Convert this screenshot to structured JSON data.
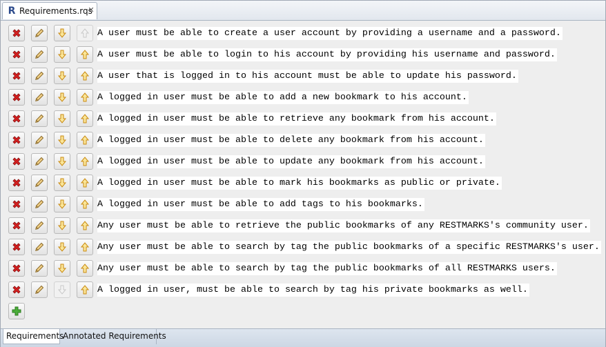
{
  "editor": {
    "tab_title": "Requirements.rqs",
    "file_icon_letter": "R"
  },
  "requirements": [
    "A user must be able to create a user account by providing a username and a password.",
    "A user must be able to login to his account by providing his username and password.",
    "A user that is logged in to his account must be able to update his password.",
    "A logged in user must be able to add a new bookmark to his account.",
    "A logged in user must be able to retrieve any bookmark from his account.",
    "A logged in user must be able to delete any bookmark from his account.",
    "A logged in user must be able to update any bookmark from his account.",
    "A logged in user must be able to mark his bookmarks as public or private.",
    "A logged in user must be able to add tags to his bookmarks.",
    "Any user must be able to retrieve the public bookmarks of any RESTMARKS's community user.",
    "Any user must be able to search by tag the public bookmarks of a specific RESTMARKS's user.",
    "Any user must be able to search by tag the public bookmarks of all RESTMARKS users.",
    "A logged in user, must be able to search by tag his private bookmarks as well."
  ],
  "row_buttons": {
    "icons": [
      "delete-icon",
      "edit-pencil-icon",
      "move-down-arrow-icon",
      "move-up-arrow-icon"
    ],
    "first_row_up_disabled": true,
    "last_row_down_disabled": true
  },
  "add_button": {
    "icon": "add-plus-icon"
  },
  "bottom_tabs": [
    {
      "label": "Requirements",
      "active": true
    },
    {
      "label": "Annotated Requirements",
      "active": false
    }
  ],
  "colors": {
    "delete": "#d42020",
    "arrow": "#e8b020",
    "add": "#3a9a2a",
    "tab_bar": "#dde5ef"
  }
}
